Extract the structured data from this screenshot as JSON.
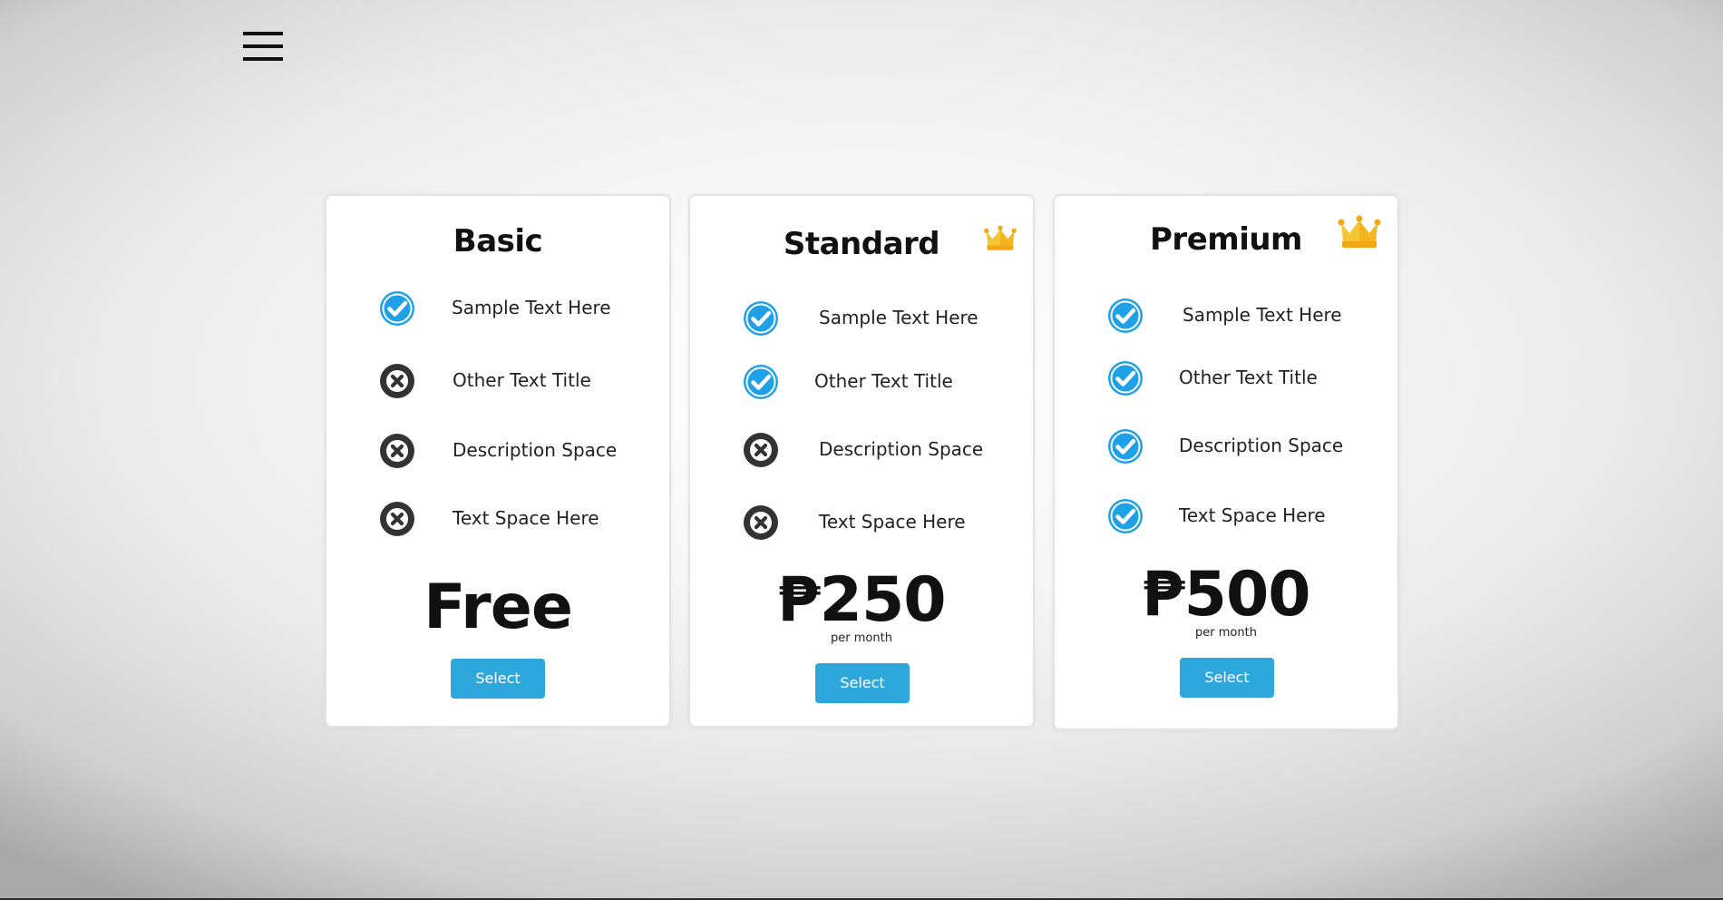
{
  "colors": {
    "accent": "#2ea8dc",
    "check": "#1ea1e6",
    "cross": "#333333",
    "crown": "#f7b71d"
  },
  "nav": {
    "menu_icon": "hamburger-menu-icon"
  },
  "plans": [
    {
      "title": "Basic",
      "features": [
        {
          "label": "Sample Text Here",
          "included": true,
          "icon": "check-circle-icon"
        },
        {
          "label": "Other Text Title",
          "included": false,
          "icon": "x-circle-icon"
        },
        {
          "label": "Description Space",
          "included": false,
          "icon": "x-circle-icon"
        },
        {
          "label": "Text Space Here",
          "included": false,
          "icon": "x-circle-icon"
        }
      ],
      "price": "Free",
      "select_label": "Select"
    },
    {
      "title": "Standard",
      "crown_icon": "crown-icon",
      "features": [
        {
          "label": "Sample Text Here",
          "included": true,
          "icon": "check-circle-icon"
        },
        {
          "label": "Other Text Title",
          "included": true,
          "icon": "check-circle-icon"
        },
        {
          "label": "Description Space",
          "included": false,
          "icon": "x-circle-icon"
        },
        {
          "label": "Text Space Here",
          "included": false,
          "icon": "x-circle-icon"
        }
      ],
      "price": "₱250",
      "period": "per month",
      "select_label": "Select"
    },
    {
      "title": "Premium",
      "crown_icon": "crown-icon",
      "features": [
        {
          "label": "Sample Text Here",
          "included": true,
          "icon": "check-circle-icon"
        },
        {
          "label": "Other Text Title",
          "included": true,
          "icon": "check-circle-icon"
        },
        {
          "label": "Description Space",
          "included": true,
          "icon": "check-circle-icon"
        },
        {
          "label": "Text Space Here",
          "included": true,
          "icon": "check-circle-icon"
        }
      ],
      "price": "₱500",
      "period": "per month",
      "select_label": "Select"
    }
  ]
}
